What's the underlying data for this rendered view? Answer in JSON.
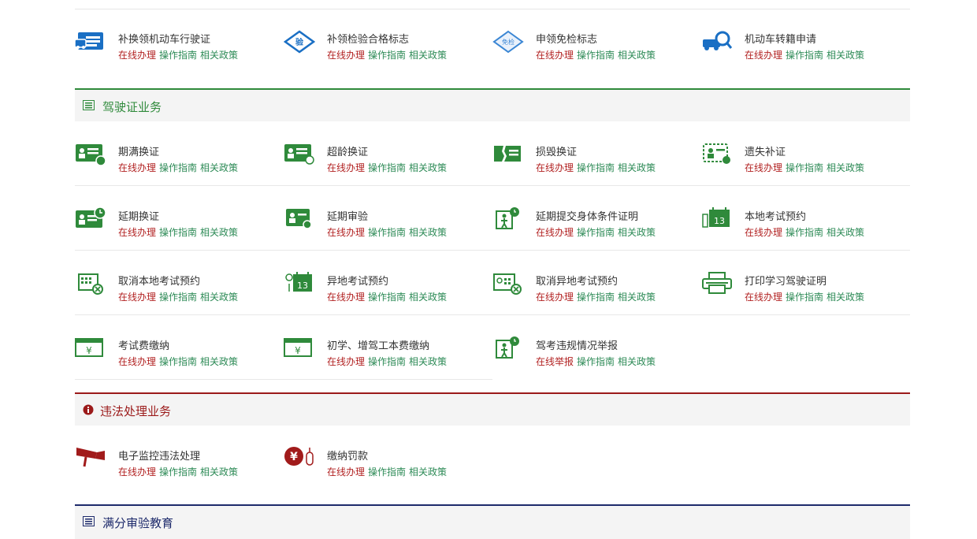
{
  "links": {
    "online": "在线办理",
    "report": "在线举报",
    "guide": "操作指南",
    "policy": "相关政策"
  },
  "vehicle_items": [
    {
      "title": "补换领机动车行驶证",
      "icon": "vehicle-license-icon",
      "color": "#1a6fc4"
    },
    {
      "title": "补领检验合格标志",
      "icon": "inspection-mark-icon",
      "color": "#1a6fc4",
      "badge": "验"
    },
    {
      "title": "申领免检标志",
      "icon": "exemption-mark-icon",
      "color": "#3a86d4",
      "badge": "免检"
    },
    {
      "title": "机动车转籍申请",
      "icon": "vehicle-transfer-icon",
      "color": "#1a6fc4"
    }
  ],
  "sections": {
    "license": "驾驶证业务",
    "violation": "违法处理业务",
    "education": "满分审验教育"
  },
  "license_rows": [
    [
      {
        "title": "期满换证",
        "icon": "license-expire-icon"
      },
      {
        "title": "超龄换证",
        "icon": "license-overage-icon"
      },
      {
        "title": "损毁换证",
        "icon": "license-damaged-icon"
      },
      {
        "title": "遗失补证",
        "icon": "license-lost-icon"
      }
    ],
    [
      {
        "title": "延期换证",
        "icon": "license-delay-icon"
      },
      {
        "title": "延期审验",
        "icon": "delay-review-icon"
      },
      {
        "title": "延期提交身体条件证明",
        "icon": "health-proof-icon"
      },
      {
        "title": "本地考试预约",
        "icon": "local-exam-icon",
        "badge": "13"
      }
    ],
    [
      {
        "title": "取消本地考试预约",
        "icon": "cancel-local-exam-icon"
      },
      {
        "title": "异地考试预约",
        "icon": "remote-exam-icon",
        "badge": "13"
      },
      {
        "title": "取消异地考试预约",
        "icon": "cancel-remote-exam-icon"
      },
      {
        "title": "打印学习驾驶证明",
        "icon": "print-icon"
      }
    ],
    [
      {
        "title": "考试费缴纳",
        "icon": "exam-fee-icon",
        "badge": "¥"
      },
      {
        "title": "初学、增驾工本费缴纳",
        "icon": "cost-fee-icon",
        "badge": "¥"
      },
      {
        "title": "驾考违规情况举报",
        "icon": "exam-report-icon",
        "report": true
      }
    ]
  ],
  "violation_items": [
    {
      "title": "电子监控违法处理",
      "icon": "camera-icon",
      "color": "#a11b1b"
    },
    {
      "title": "缴纳罚款",
      "icon": "fine-payment-icon",
      "color": "#a11b1b",
      "badge": "¥"
    }
  ],
  "colors": {
    "green": "#2f8a3b",
    "red": "#9b1a1a",
    "navy": "#1d2a6b",
    "blue": "#1a6fc4"
  }
}
